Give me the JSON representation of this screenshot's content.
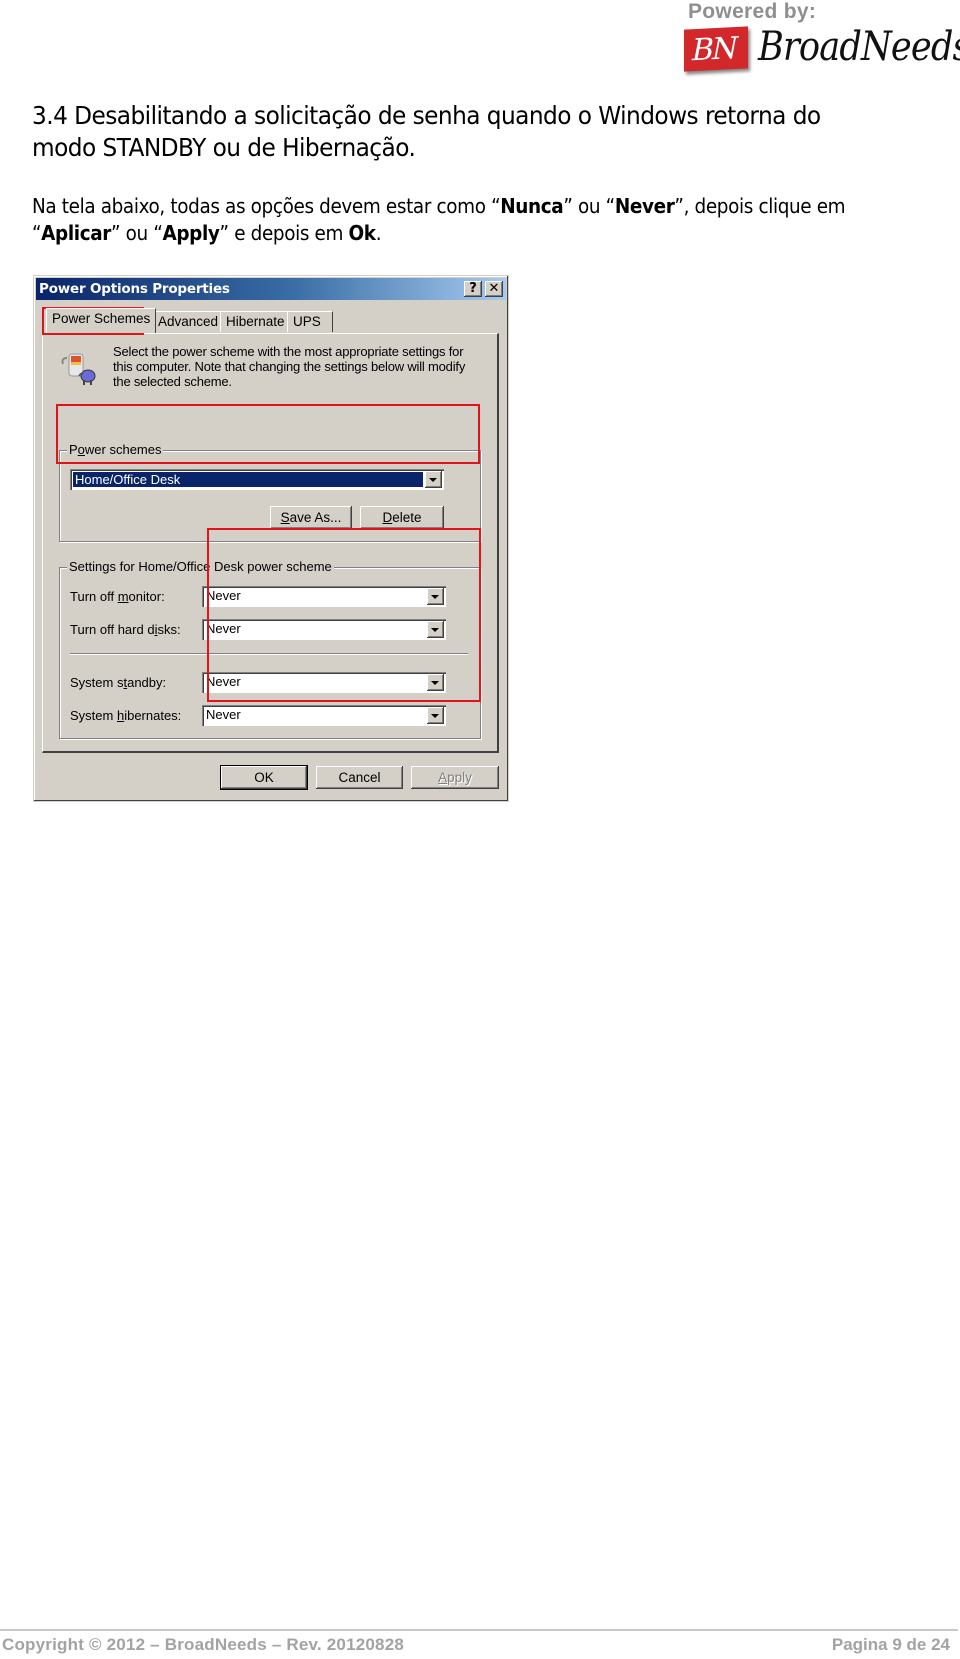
{
  "header": {
    "powered_by": "Powered by:",
    "logo_mark": "BN",
    "logo_text": "BroadNeeds",
    "brand_color": "#d3282b"
  },
  "section": {
    "heading": "3.4 Desabilitando a solicitação de senha quando o Windows retorna do modo STANDBY ou de Hibernação.",
    "paragraph": {
      "p1": "Na tela abaixo, todas as opções devem estar como “",
      "b1": "Nunca",
      "p2": "” ou “",
      "b2": "Never",
      "p3": "”, depois clique em “",
      "b3": "Aplicar",
      "p4": "” ou “",
      "b4": "Apply",
      "p5": "” e depois em ",
      "b5": "Ok",
      "p6": "."
    }
  },
  "dialog": {
    "title": "Power Options Properties",
    "help_button": "?",
    "close_button": "✕",
    "tabs": [
      {
        "label": "Power Schemes",
        "active": true
      },
      {
        "label": "Advanced",
        "active": false
      },
      {
        "label": "Hibernate",
        "active": false
      },
      {
        "label": "UPS",
        "active": false
      }
    ],
    "intro_text": "Select the power scheme with the most appropriate settings for this computer. Note that changing the settings below will modify the selected scheme.",
    "power_schemes_group": {
      "label_pre": "P",
      "label_u": "o",
      "label_post": "wer schemes",
      "selected_value": "Home/Office Desk",
      "save_as_u": "S",
      "save_as_rest": "ave As...",
      "delete_u": "D",
      "delete_rest": "elete"
    },
    "settings_group": {
      "label": "Settings for Home/Office Desk power scheme",
      "rows": [
        {
          "label_pre": "Turn off ",
          "label_u": "m",
          "label_post": "onitor:",
          "value": "Never"
        },
        {
          "label_pre": "Turn off hard d",
          "label_u": "i",
          "label_post": "sks:",
          "value": "Never"
        },
        {
          "label_pre": "System s",
          "label_u": "t",
          "label_post": "andby:",
          "value": "Never"
        },
        {
          "label_pre": "System ",
          "label_u": "h",
          "label_post": "ibernates:",
          "value": "Never"
        }
      ]
    },
    "buttons": {
      "ok": "OK",
      "cancel": "Cancel",
      "apply_u": "A",
      "apply_rest": "pply"
    },
    "highlight_color": "#e0141a"
  },
  "footer": {
    "copyright": "Copyright © 2012 – BroadNeeds – Rev. 20120828",
    "page": "Pagina 9 de 24"
  }
}
